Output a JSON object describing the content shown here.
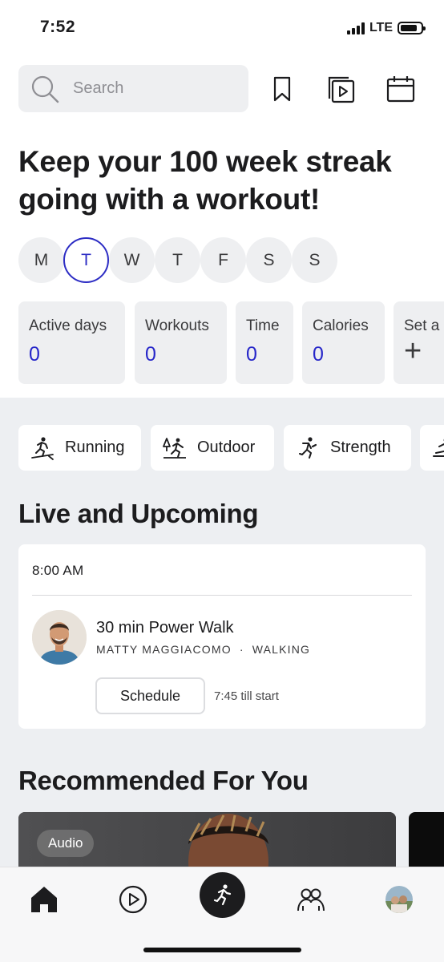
{
  "status": {
    "time": "7:52",
    "network": "LTE"
  },
  "search": {
    "placeholder": "Search"
  },
  "headline": "Keep your 100 week streak going with a workout!",
  "week_days": [
    {
      "label": "M",
      "active": false
    },
    {
      "label": "T",
      "active": true
    },
    {
      "label": "W",
      "active": false
    },
    {
      "label": "T",
      "active": false
    },
    {
      "label": "F",
      "active": false
    },
    {
      "label": "S",
      "active": false
    },
    {
      "label": "S",
      "active": false
    }
  ],
  "stats": [
    {
      "label": "Active days",
      "value": "0"
    },
    {
      "label": "Workouts",
      "value": "0"
    },
    {
      "label": "Time",
      "value": "0"
    },
    {
      "label": "Calories",
      "value": "0"
    },
    {
      "label": "Set a",
      "value": "+"
    }
  ],
  "categories": [
    {
      "label": "Running",
      "icon": "running-icon"
    },
    {
      "label": "Outdoor",
      "icon": "outdoor-icon"
    },
    {
      "label": "Strength",
      "icon": "strength-icon"
    }
  ],
  "live": {
    "title": "Live and Upcoming",
    "time": "8:00 AM",
    "class_title": "30 min Power Walk",
    "instructor": "MATTY MAGGIACOMO",
    "separator": "·",
    "discipline": "WALKING",
    "schedule_label": "Schedule",
    "till_start": "7:45 till start"
  },
  "recommended": {
    "title": "Recommended For You",
    "badge": "Audio"
  },
  "colors": {
    "accent": "#2626c9",
    "section_bg": "#edeff2",
    "chip_bg": "#eeeff1"
  }
}
